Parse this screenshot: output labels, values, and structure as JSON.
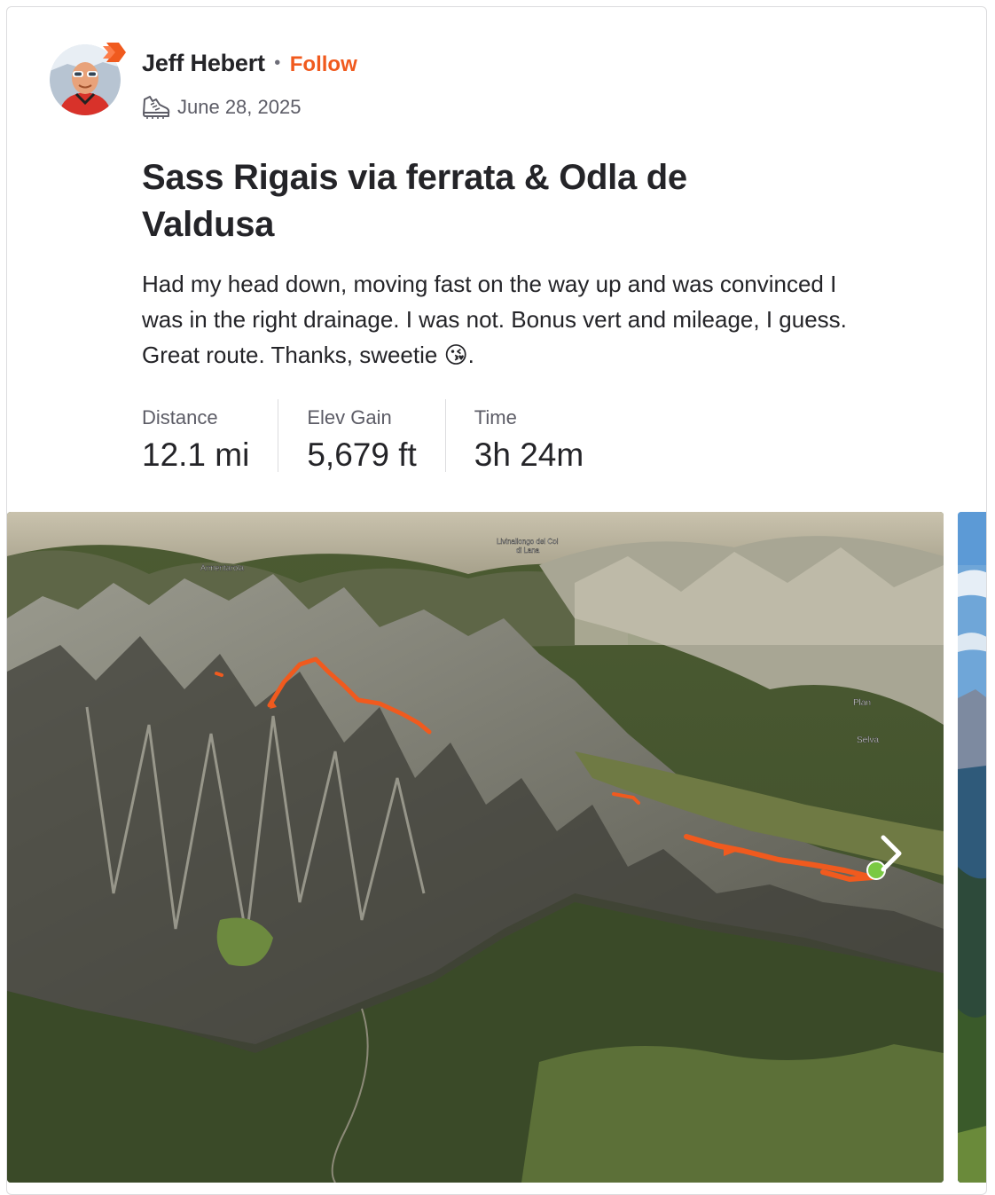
{
  "athlete": {
    "name": "Jeff Hebert",
    "separator": "•",
    "follow_label": "Follow"
  },
  "activity": {
    "type_icon": "hiking-shoe-icon",
    "date": "June 28, 2025",
    "title": "Sass Rigais via ferrata & Odla de Valdusa",
    "description": "Had my head down, moving fast on the way up and was convinced I was in the right drainage. I was not. Bonus vert and mileage, I guess. Great route. Thanks, sweetie 😘."
  },
  "stats": [
    {
      "label": "Distance",
      "value": "12.1 mi"
    },
    {
      "label": "Elev Gain",
      "value": "5,679 ft"
    },
    {
      "label": "Time",
      "value": "3h 24m"
    }
  ],
  "map": {
    "labels": {
      "armentarola": "Armentarola",
      "livinallongo_1": "Livinallongo del Col",
      "livinallongo_2": "di Lana",
      "plan": "Plan",
      "selva": "Selva"
    },
    "route_color": "#f05a1e",
    "start_color": "#7ac943"
  },
  "colors": {
    "accent": "#f05a1e",
    "text": "#242428",
    "muted": "#5c5c66"
  }
}
